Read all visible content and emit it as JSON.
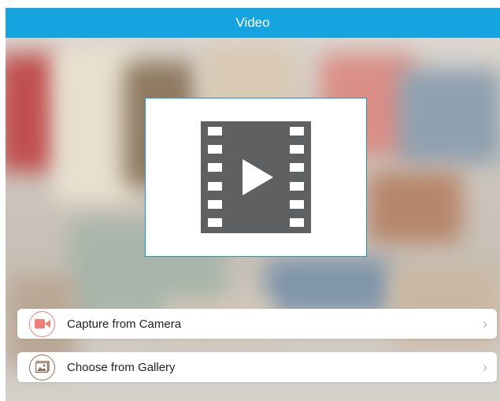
{
  "header": {
    "title": "Video"
  },
  "video_card": {
    "icon": "film-play-icon"
  },
  "actions": [
    {
      "label": "Capture from Camera",
      "icon": "video-camera-icon",
      "accent": "#f07f78"
    },
    {
      "label": "Choose from Gallery",
      "icon": "image-gallery-icon",
      "accent": "#8b6f57"
    }
  ],
  "colors": {
    "header": "#16a4e0",
    "card_border": "#1a9ad6",
    "film_icon": "#5f6061",
    "chevron": "#b5b5b5"
  }
}
